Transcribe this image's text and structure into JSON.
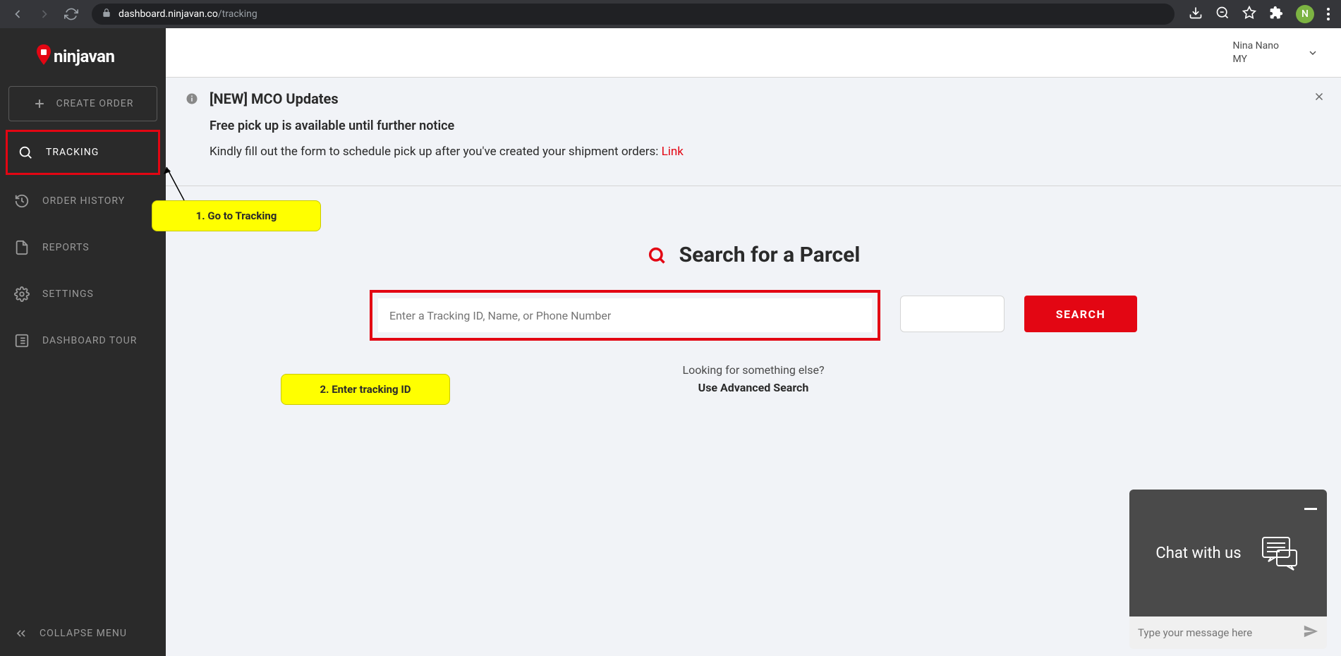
{
  "browser": {
    "url_host": "dashboard.ninjavan.co",
    "url_path": "/tracking",
    "avatar_letter": "N"
  },
  "sidebar": {
    "brand": "ninjavan",
    "create_order": "CREATE ORDER",
    "items": [
      {
        "label": "TRACKING"
      },
      {
        "label": "ORDER HISTORY"
      },
      {
        "label": "REPORTS"
      },
      {
        "label": "SETTINGS"
      },
      {
        "label": "DASHBOARD TOUR"
      }
    ],
    "collapse": "COLLAPSE MENU"
  },
  "topbar": {
    "user_name": "Nina Nano",
    "user_region": "MY"
  },
  "banner": {
    "title": "[NEW] MCO Updates",
    "line1": "Free pick up is available until further notice",
    "line2_pre": "Kindly fill out the form to schedule pick up after you've created your shipment orders: ",
    "line2_link": "Link"
  },
  "search": {
    "heading": "Search for a Parcel",
    "placeholder": "Enter a Tracking ID, Name, or Phone Number",
    "button": "SEARCH",
    "sub1": "Looking for something else?",
    "sub2": "Use Advanced Search"
  },
  "annotations": {
    "a1": "1. Go to Tracking",
    "a2": "2. Enter tracking ID"
  },
  "chat": {
    "title": "Chat with us",
    "placeholder": "Type your message here"
  }
}
